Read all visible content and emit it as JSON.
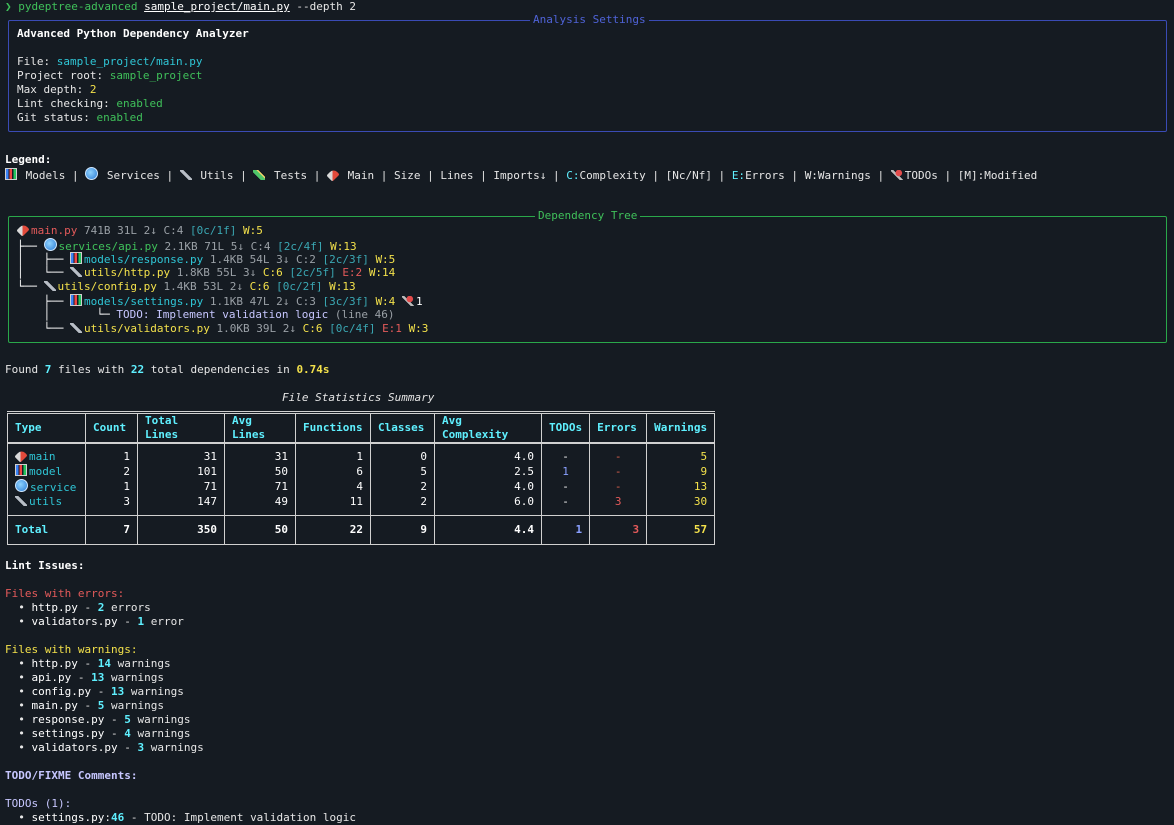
{
  "command": {
    "prompt": "❯",
    "program": "pydeptree-advanced",
    "path": "sample_project/main.py",
    "args": "--depth 2"
  },
  "settings_panel": {
    "title": "Analysis Settings",
    "heading": "Advanced Python Dependency Analyzer",
    "rows": [
      {
        "label": "File: ",
        "value": "sample_project/main.py"
      },
      {
        "label": "Project root: ",
        "value": "sample_project"
      },
      {
        "label": "Max depth: ",
        "value": "2"
      },
      {
        "label": "Lint checking: ",
        "value": "enabled"
      },
      {
        "label": "Git status: ",
        "value": "enabled"
      }
    ]
  },
  "legend": {
    "title": "Legend:",
    "items": {
      "models": "Models",
      "services": "Services",
      "utils": "Utils",
      "tests": "Tests",
      "main": "Main",
      "size": "Size",
      "lines": "Lines",
      "imports": "Imports↓",
      "complexity_key": "C:",
      "complexity": "Complexity",
      "ncnf": "[Nc/Nf]",
      "errors_key": "E:",
      "errors": "Errors",
      "warnings": "W:Warnings",
      "todos": "TODOs",
      "modified_key": "[M]",
      "modified": ":Modified"
    }
  },
  "tree_panel": {
    "title": "Dependency Tree",
    "nodes": [
      {
        "prefix": "",
        "icon": "rocket-icon",
        "name": "main.py",
        "size": "741B",
        "lines": "31L",
        "imports": "2↓",
        "complexity": "C:4",
        "ncnf": "[0c/1f]",
        "errors": "",
        "warnings": "W:5",
        "todo": ""
      },
      {
        "prefix": "└── ",
        "icon": "globe-icon",
        "name": "services/api.py",
        "size": "2.1KB",
        "lines": "71L",
        "imports": "5↓",
        "complexity": "C:4",
        "ncnf": "[2c/4f]",
        "errors": "",
        "warnings": "W:13",
        "todo": ""
      },
      {
        "prefix": "    ├── ",
        "icon": "chart-icon",
        "name": "models/response.py",
        "size": "1.4KB",
        "lines": "54L",
        "imports": "3↓",
        "complexity": "C:2",
        "ncnf": "[2c/3f]",
        "errors": "",
        "warnings": "W:5",
        "todo": ""
      },
      {
        "prefix": "    └── ",
        "icon": "wrench-icon",
        "name": "utils/http.py",
        "size": "1.8KB",
        "lines": "55L",
        "imports": "3↓",
        "complexity": "C:6",
        "ncnf": "[2c/5f]",
        "errors": "E:2",
        "warnings": "W:14",
        "todo": ""
      },
      {
        "prefix": "└── ",
        "icon": "wrench-icon",
        "name": "utils/config.py",
        "size": "1.4KB",
        "lines": "53L",
        "imports": "2↓",
        "complexity": "C:6",
        "ncnf": "[0c/2f]",
        "errors": "",
        "warnings": "W:13",
        "todo": ""
      },
      {
        "prefix": "    ├── ",
        "icon": "chart-icon",
        "name": "models/settings.py",
        "size": "1.1KB",
        "lines": "47L",
        "imports": "2↓",
        "complexity": "C:3",
        "ncnf": "[3c/3f]",
        "errors": "",
        "warnings": "W:4",
        "todo": "1"
      },
      {
        "prefix": "    └── ",
        "icon": "wrench-icon",
        "name": "utils/validators.py",
        "size": "1.0KB",
        "lines": "39L",
        "imports": "2↓",
        "complexity": "C:6",
        "ncnf": "[0c/4f]",
        "errors": "E:1",
        "warnings": "W:3",
        "todo": ""
      }
    ],
    "todo_line": {
      "text": "TODO: Implement validation logic",
      "loc": "(line 46)"
    }
  },
  "found": {
    "pre": "Found ",
    "files": "7",
    "mid": " files with ",
    "deps": "22",
    "post": " total dependencies in ",
    "time": "0.74s"
  },
  "stats_table": {
    "title": "File Statistics Summary",
    "columns": [
      "Type",
      "Count",
      "Total Lines",
      "Avg Lines",
      "Functions",
      "Classes",
      "Avg Complexity",
      "TODOs",
      "Errors",
      "Warnings"
    ],
    "rows": [
      {
        "icon": "rocket-icon",
        "type": "main",
        "count": "1",
        "total": "31",
        "avg": "31",
        "functions": "1",
        "classes": "0",
        "complexity": "4.0",
        "todos": "-",
        "errors": "-",
        "warnings": "5"
      },
      {
        "icon": "chart-icon",
        "type": "model",
        "count": "2",
        "total": "101",
        "avg": "50",
        "functions": "6",
        "classes": "5",
        "complexity": "2.5",
        "todos": "1",
        "errors": "-",
        "warnings": "9"
      },
      {
        "icon": "globe-icon",
        "type": "service",
        "count": "1",
        "total": "71",
        "avg": "71",
        "functions": "4",
        "classes": "2",
        "complexity": "4.0",
        "todos": "-",
        "errors": "-",
        "warnings": "13"
      },
      {
        "icon": "wrench-icon",
        "type": "utils",
        "count": "3",
        "total": "147",
        "avg": "49",
        "functions": "11",
        "classes": "2",
        "complexity": "6.0",
        "todos": "-",
        "errors": "3",
        "warnings": "30"
      }
    ],
    "total": {
      "type": "Total",
      "count": "7",
      "total": "350",
      "avg": "50",
      "functions": "22",
      "classes": "9",
      "complexity": "4.4",
      "todos": "1",
      "errors": "3",
      "warnings": "57"
    }
  },
  "lint": {
    "title": "Lint Issues:",
    "errors_title": "Files with errors:",
    "errors": [
      {
        "file": "http.py",
        "count": "2",
        "unit": " errors"
      },
      {
        "file": "validators.py",
        "count": "1",
        "unit": " error"
      }
    ],
    "warnings_title": "Files with warnings:",
    "warnings": [
      {
        "file": "http.py",
        "count": "14",
        "unit": " warnings"
      },
      {
        "file": "api.py",
        "count": "13",
        "unit": " warnings"
      },
      {
        "file": "config.py",
        "count": "13",
        "unit": " warnings"
      },
      {
        "file": "main.py",
        "count": "5",
        "unit": " warnings"
      },
      {
        "file": "response.py",
        "count": "5",
        "unit": " warnings"
      },
      {
        "file": "settings.py",
        "count": "4",
        "unit": " warnings"
      },
      {
        "file": "validators.py",
        "count": "3",
        "unit": " warnings"
      }
    ]
  },
  "todo_section": {
    "title": "TODO/FIXME Comments:",
    "subtitle": "TODOs (1):",
    "items": [
      {
        "file": "settings.py",
        "line": "46",
        "text": " - TODO: Implement validation logic"
      }
    ]
  }
}
